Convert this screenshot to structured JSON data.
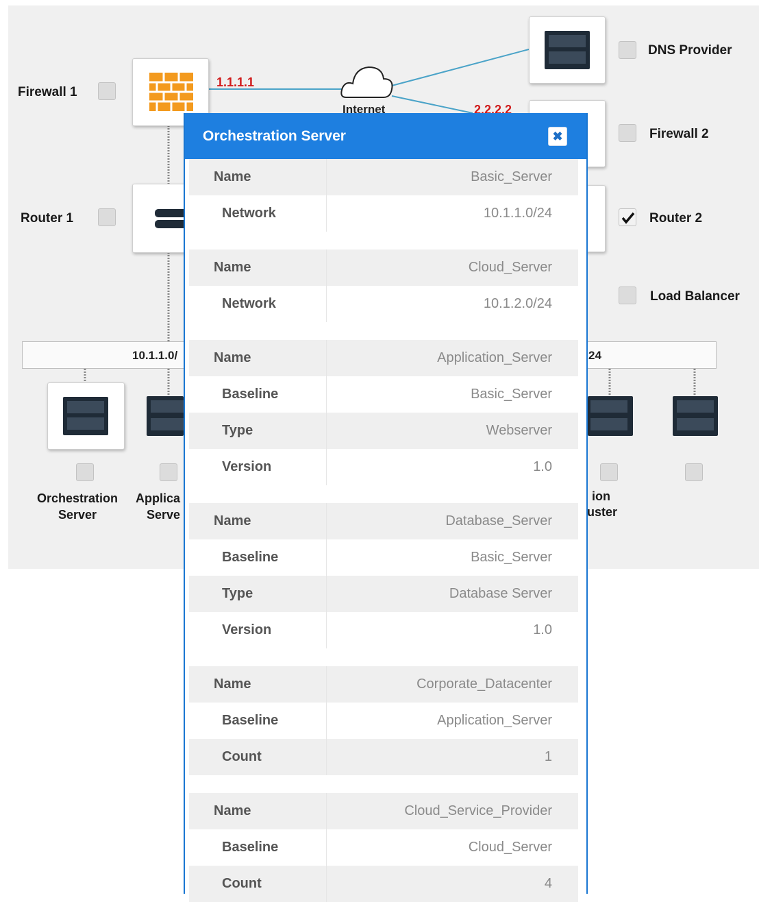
{
  "diagram": {
    "firewall1_label": "Firewall 1",
    "router1_label": "Router 1",
    "dns_label": "DNS Provider",
    "firewall2_label": "Firewall 2",
    "router2_label": "Router 2",
    "load_balancer_label": "Load Balancer",
    "ip_firewall1": "1.1.1.1",
    "ip_firewall2": "2.2.2.2",
    "internet_label": "Internet",
    "subnet_left": "10.1.1.0/",
    "subnet_right": "24",
    "server_labels": {
      "orchestration": "Orchestration\nServer",
      "application_partial": "Applica\nServe",
      "right_partial_top": "ion",
      "right_partial_bottom": "uster"
    },
    "router2_checked": true
  },
  "modal": {
    "title": "Orchestration Server",
    "close_icon": "close-icon",
    "groups": [
      {
        "rows": [
          {
            "key": "Name",
            "value": "Basic_Server"
          },
          {
            "key": "Network",
            "value": "10.1.1.0/24"
          }
        ]
      },
      {
        "rows": [
          {
            "key": "Name",
            "value": "Cloud_Server"
          },
          {
            "key": "Network",
            "value": "10.1.2.0/24"
          }
        ]
      },
      {
        "rows": [
          {
            "key": "Name",
            "value": "Application_Server"
          },
          {
            "key": "Baseline",
            "value": "Basic_Server"
          },
          {
            "key": "Type",
            "value": "Webserver"
          },
          {
            "key": "Version",
            "value": "1.0"
          }
        ]
      },
      {
        "rows": [
          {
            "key": "Name",
            "value": "Database_Server"
          },
          {
            "key": "Baseline",
            "value": "Basic_Server"
          },
          {
            "key": "Type",
            "value": "Database Server"
          },
          {
            "key": "Version",
            "value": "1.0"
          }
        ]
      },
      {
        "rows": [
          {
            "key": "Name",
            "value": "Corporate_Datacenter"
          },
          {
            "key": "Baseline",
            "value": "Application_Server"
          },
          {
            "key": "Count",
            "value": "1"
          }
        ]
      },
      {
        "rows": [
          {
            "key": "Name",
            "value": "Cloud_Service_Provider"
          },
          {
            "key": "Baseline",
            "value": "Cloud_Server"
          },
          {
            "key": "Count",
            "value": "4"
          }
        ]
      }
    ]
  },
  "colors": {
    "modal_header": "#1e7fe0",
    "ip_text": "#d01a1a",
    "firewall": "#f39a1e"
  }
}
